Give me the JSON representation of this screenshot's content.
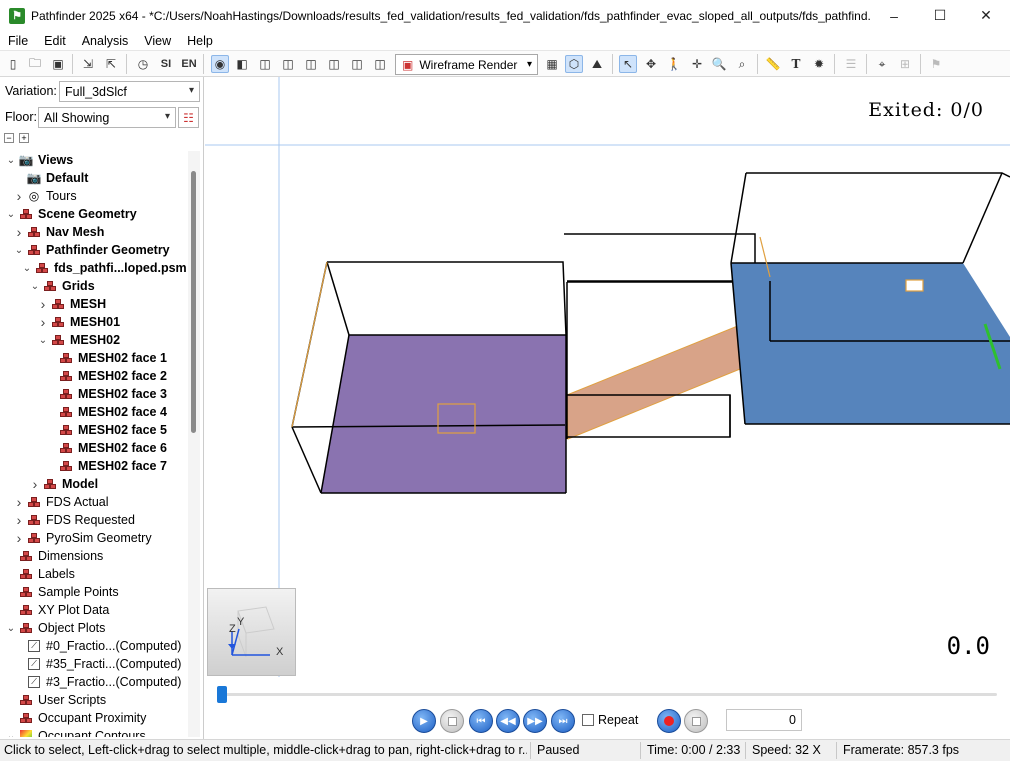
{
  "window": {
    "title": "Pathfinder 2025 x64 - *C:/Users/NoahHastings/Downloads/results_fed_validation/results_fed_validation/fds_pathfinder_evac_sloped_all_outputs/fds_pathfind...",
    "minimize_glyph": "–",
    "maximize_glyph": "☐",
    "close_glyph": "✕"
  },
  "menu": [
    "File",
    "Edit",
    "Analysis",
    "View",
    "Help"
  ],
  "toolbar": {
    "render_mode": "Wireframe Render",
    "units_si": "SI",
    "units_en": "EN",
    "icons": [
      "new-icon",
      "open-icon",
      "save-icon",
      "import-icon",
      "export-icon",
      "clock-icon",
      "si-units",
      "en-units",
      "view-icon",
      "view2-icon",
      "box1-icon",
      "box2-icon",
      "box3-icon",
      "box4-icon",
      "box5-icon",
      "render-mode",
      "grid-icon",
      "wire-icon",
      "terrain-icon",
      "select-icon",
      "orbit-icon",
      "walk-icon",
      "pan-icon",
      "zoom-icon",
      "zoom-box-icon",
      "measure-icon",
      "text-icon",
      "settings-icon",
      "filter-icon",
      "center-icon",
      "fit-icon",
      "flag-icon"
    ]
  },
  "left_panel": {
    "variation_label": "Variation:",
    "variation_value": "Full_3dSlcf",
    "floor_label": "Floor:",
    "floor_value": "All Showing",
    "tree": [
      {
        "label": "Views",
        "level": 0,
        "expander": "open",
        "bold": true,
        "icon": "camera-icon"
      },
      {
        "label": "Default",
        "level": 1,
        "expander": "none",
        "bold": true,
        "icon": "camera-icon"
      },
      {
        "label": "Tours",
        "level": 1,
        "expander": "closed",
        "bold": false,
        "icon": "tour-icon"
      },
      {
        "label": "Scene Geometry",
        "level": 0,
        "expander": "open",
        "bold": true,
        "icon": "geometry-icon"
      },
      {
        "label": "Nav Mesh",
        "level": 1,
        "expander": "closed",
        "bold": true,
        "icon": "geometry-icon"
      },
      {
        "label": "Pathfinder Geometry",
        "level": 1,
        "expander": "open",
        "bold": true,
        "icon": "geometry-icon"
      },
      {
        "label": "fds_pathfi...loped.psm",
        "level": 2,
        "expander": "open",
        "bold": true,
        "icon": "geometry-icon"
      },
      {
        "label": "Grids",
        "level": 3,
        "expander": "open",
        "bold": true,
        "icon": "geometry-icon"
      },
      {
        "label": "MESH",
        "level": 4,
        "expander": "closed",
        "bold": true,
        "icon": "geometry-icon"
      },
      {
        "label": "MESH01",
        "level": 4,
        "expander": "closed",
        "bold": true,
        "icon": "geometry-icon"
      },
      {
        "label": "MESH02",
        "level": 4,
        "expander": "open",
        "bold": true,
        "icon": "geometry-icon"
      },
      {
        "label": "MESH02 face 1",
        "level": 5,
        "expander": "none",
        "bold": true,
        "icon": "geometry-icon"
      },
      {
        "label": "MESH02 face 2",
        "level": 5,
        "expander": "none",
        "bold": true,
        "icon": "geometry-icon"
      },
      {
        "label": "MESH02 face 3",
        "level": 5,
        "expander": "none",
        "bold": true,
        "icon": "geometry-icon"
      },
      {
        "label": "MESH02 face 4",
        "level": 5,
        "expander": "none",
        "bold": true,
        "icon": "geometry-icon"
      },
      {
        "label": "MESH02 face 5",
        "level": 5,
        "expander": "none",
        "bold": true,
        "icon": "geometry-icon"
      },
      {
        "label": "MESH02 face 6",
        "level": 5,
        "expander": "none",
        "bold": true,
        "icon": "geometry-icon"
      },
      {
        "label": "MESH02 face 7",
        "level": 5,
        "expander": "none",
        "bold": true,
        "icon": "geometry-icon"
      },
      {
        "label": "Model",
        "level": 3,
        "expander": "closed",
        "bold": true,
        "icon": "geometry-icon"
      },
      {
        "label": "FDS Actual",
        "level": 1,
        "expander": "closed",
        "bold": false,
        "icon": "geometry-icon"
      },
      {
        "label": "FDS Requested",
        "level": 1,
        "expander": "closed",
        "bold": false,
        "icon": "geometry-icon"
      },
      {
        "label": "PyroSim Geometry",
        "level": 1,
        "expander": "closed",
        "bold": false,
        "icon": "geometry-icon"
      },
      {
        "label": "Dimensions",
        "level": 0,
        "expander": "none",
        "bold": false,
        "icon": "geometry-icon"
      },
      {
        "label": "Labels",
        "level": 0,
        "expander": "none",
        "bold": false,
        "icon": "geometry-icon"
      },
      {
        "label": "Sample Points",
        "level": 0,
        "expander": "none",
        "bold": false,
        "icon": "geometry-icon"
      },
      {
        "label": "XY Plot Data",
        "level": 0,
        "expander": "none",
        "bold": false,
        "icon": "geometry-icon"
      },
      {
        "label": "Object Plots",
        "level": 0,
        "expander": "open",
        "bold": false,
        "icon": "geometry-icon"
      },
      {
        "label": "#0_Fractio...(Computed)",
        "level": 1,
        "expander": "none",
        "bold": false,
        "icon": "plot-icon"
      },
      {
        "label": "#35_Fracti...(Computed)",
        "level": 1,
        "expander": "none",
        "bold": false,
        "icon": "plot-icon"
      },
      {
        "label": "#3_Fractio...(Computed)",
        "level": 1,
        "expander": "none",
        "bold": false,
        "icon": "plot-icon"
      },
      {
        "label": "User Scripts",
        "level": 0,
        "expander": "none",
        "bold": false,
        "icon": "geometry-icon"
      },
      {
        "label": "Occupant Proximity",
        "level": 0,
        "expander": "none",
        "bold": false,
        "icon": "geometry-icon"
      },
      {
        "label": "Occupant Contours",
        "level": 0,
        "expander": "open",
        "bold": false,
        "icon": "contour-icon"
      }
    ]
  },
  "viewport": {
    "exited_text": "Exited: 0/0",
    "time_readout": "0.0",
    "axis_labels": {
      "x": "X",
      "y": "Y",
      "z": "Z"
    },
    "colors": {
      "room_left": "#8a73b0",
      "room_right": "#5684bc",
      "ramp": "#d8a388",
      "door_outline": "#e0a040",
      "green_edge": "#2ec02e"
    }
  },
  "playback": {
    "repeat_label": "Repeat",
    "frame_value": "0",
    "progress": 0.0
  },
  "status": {
    "hint": "Click to select, Left-click+drag to select multiple, middle-click+drag to pan, right-click+drag to r...",
    "state": "Paused",
    "time": "Time: 0:00 / 2:33",
    "speed": "Speed: 32 X",
    "framerate": "Framerate: 857.3 fps"
  }
}
